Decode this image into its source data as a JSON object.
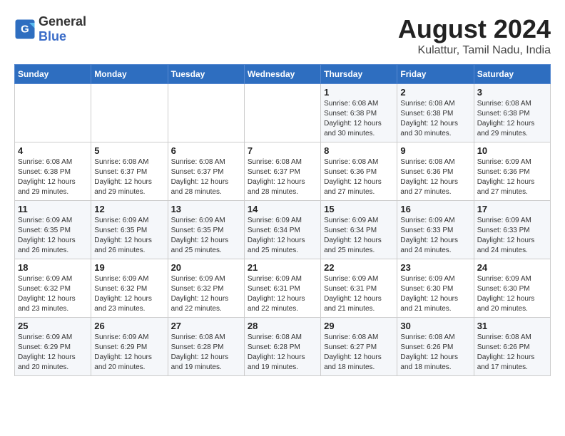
{
  "header": {
    "logo_general": "General",
    "logo_blue": "Blue",
    "month_year": "August 2024",
    "location": "Kulattur, Tamil Nadu, India"
  },
  "weekdays": [
    "Sunday",
    "Monday",
    "Tuesday",
    "Wednesday",
    "Thursday",
    "Friday",
    "Saturday"
  ],
  "weeks": [
    [
      {
        "day": "",
        "detail": ""
      },
      {
        "day": "",
        "detail": ""
      },
      {
        "day": "",
        "detail": ""
      },
      {
        "day": "",
        "detail": ""
      },
      {
        "day": "1",
        "detail": "Sunrise: 6:08 AM\nSunset: 6:38 PM\nDaylight: 12 hours\nand 30 minutes."
      },
      {
        "day": "2",
        "detail": "Sunrise: 6:08 AM\nSunset: 6:38 PM\nDaylight: 12 hours\nand 30 minutes."
      },
      {
        "day": "3",
        "detail": "Sunrise: 6:08 AM\nSunset: 6:38 PM\nDaylight: 12 hours\nand 29 minutes."
      }
    ],
    [
      {
        "day": "4",
        "detail": "Sunrise: 6:08 AM\nSunset: 6:38 PM\nDaylight: 12 hours\nand 29 minutes."
      },
      {
        "day": "5",
        "detail": "Sunrise: 6:08 AM\nSunset: 6:37 PM\nDaylight: 12 hours\nand 29 minutes."
      },
      {
        "day": "6",
        "detail": "Sunrise: 6:08 AM\nSunset: 6:37 PM\nDaylight: 12 hours\nand 28 minutes."
      },
      {
        "day": "7",
        "detail": "Sunrise: 6:08 AM\nSunset: 6:37 PM\nDaylight: 12 hours\nand 28 minutes."
      },
      {
        "day": "8",
        "detail": "Sunrise: 6:08 AM\nSunset: 6:36 PM\nDaylight: 12 hours\nand 27 minutes."
      },
      {
        "day": "9",
        "detail": "Sunrise: 6:08 AM\nSunset: 6:36 PM\nDaylight: 12 hours\nand 27 minutes."
      },
      {
        "day": "10",
        "detail": "Sunrise: 6:09 AM\nSunset: 6:36 PM\nDaylight: 12 hours\nand 27 minutes."
      }
    ],
    [
      {
        "day": "11",
        "detail": "Sunrise: 6:09 AM\nSunset: 6:35 PM\nDaylight: 12 hours\nand 26 minutes."
      },
      {
        "day": "12",
        "detail": "Sunrise: 6:09 AM\nSunset: 6:35 PM\nDaylight: 12 hours\nand 26 minutes."
      },
      {
        "day": "13",
        "detail": "Sunrise: 6:09 AM\nSunset: 6:35 PM\nDaylight: 12 hours\nand 25 minutes."
      },
      {
        "day": "14",
        "detail": "Sunrise: 6:09 AM\nSunset: 6:34 PM\nDaylight: 12 hours\nand 25 minutes."
      },
      {
        "day": "15",
        "detail": "Sunrise: 6:09 AM\nSunset: 6:34 PM\nDaylight: 12 hours\nand 25 minutes."
      },
      {
        "day": "16",
        "detail": "Sunrise: 6:09 AM\nSunset: 6:33 PM\nDaylight: 12 hours\nand 24 minutes."
      },
      {
        "day": "17",
        "detail": "Sunrise: 6:09 AM\nSunset: 6:33 PM\nDaylight: 12 hours\nand 24 minutes."
      }
    ],
    [
      {
        "day": "18",
        "detail": "Sunrise: 6:09 AM\nSunset: 6:32 PM\nDaylight: 12 hours\nand 23 minutes."
      },
      {
        "day": "19",
        "detail": "Sunrise: 6:09 AM\nSunset: 6:32 PM\nDaylight: 12 hours\nand 23 minutes."
      },
      {
        "day": "20",
        "detail": "Sunrise: 6:09 AM\nSunset: 6:32 PM\nDaylight: 12 hours\nand 22 minutes."
      },
      {
        "day": "21",
        "detail": "Sunrise: 6:09 AM\nSunset: 6:31 PM\nDaylight: 12 hours\nand 22 minutes."
      },
      {
        "day": "22",
        "detail": "Sunrise: 6:09 AM\nSunset: 6:31 PM\nDaylight: 12 hours\nand 21 minutes."
      },
      {
        "day": "23",
        "detail": "Sunrise: 6:09 AM\nSunset: 6:30 PM\nDaylight: 12 hours\nand 21 minutes."
      },
      {
        "day": "24",
        "detail": "Sunrise: 6:09 AM\nSunset: 6:30 PM\nDaylight: 12 hours\nand 20 minutes."
      }
    ],
    [
      {
        "day": "25",
        "detail": "Sunrise: 6:09 AM\nSunset: 6:29 PM\nDaylight: 12 hours\nand 20 minutes."
      },
      {
        "day": "26",
        "detail": "Sunrise: 6:09 AM\nSunset: 6:29 PM\nDaylight: 12 hours\nand 20 minutes."
      },
      {
        "day": "27",
        "detail": "Sunrise: 6:08 AM\nSunset: 6:28 PM\nDaylight: 12 hours\nand 19 minutes."
      },
      {
        "day": "28",
        "detail": "Sunrise: 6:08 AM\nSunset: 6:28 PM\nDaylight: 12 hours\nand 19 minutes."
      },
      {
        "day": "29",
        "detail": "Sunrise: 6:08 AM\nSunset: 6:27 PM\nDaylight: 12 hours\nand 18 minutes."
      },
      {
        "day": "30",
        "detail": "Sunrise: 6:08 AM\nSunset: 6:26 PM\nDaylight: 12 hours\nand 18 minutes."
      },
      {
        "day": "31",
        "detail": "Sunrise: 6:08 AM\nSunset: 6:26 PM\nDaylight: 12 hours\nand 17 minutes."
      }
    ]
  ]
}
